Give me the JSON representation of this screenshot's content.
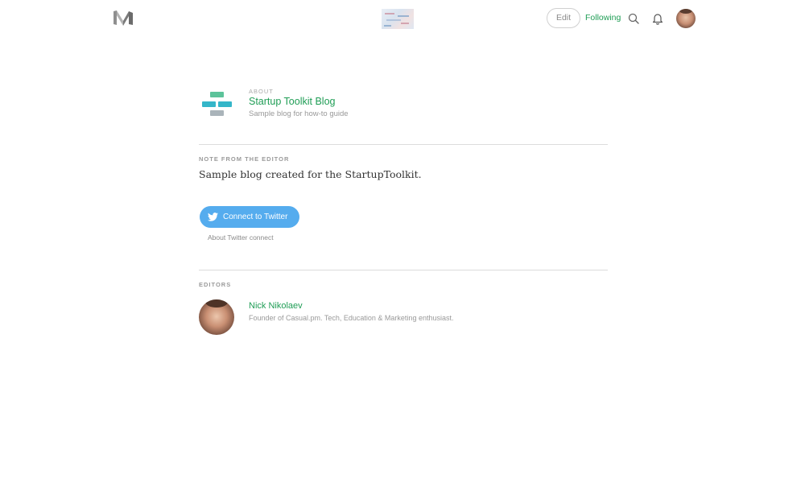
{
  "header": {
    "logo_icon": "medium-m-logo",
    "edit_label": "Edit",
    "following_label": "Following",
    "search_icon": "search-icon",
    "notifications_icon": "bell-icon",
    "accent_color": "#1f9d55"
  },
  "about": {
    "kicker": "ABOUT",
    "title": "Startup Toolkit Blog",
    "description": "Sample blog for how-to guide"
  },
  "editor_note": {
    "label": "NOTE FROM THE EDITOR",
    "text": "Sample blog created for the StartupToolkit."
  },
  "twitter": {
    "button_label": "Connect to Twitter",
    "about_link": "About Twitter connect",
    "button_color": "#55acee"
  },
  "editors": {
    "label": "EDITORS",
    "items": [
      {
        "name": "Nick Nikolaev",
        "bio": "Founder of Casual.pm. Tech, Education & Marketing enthusiast."
      }
    ]
  }
}
